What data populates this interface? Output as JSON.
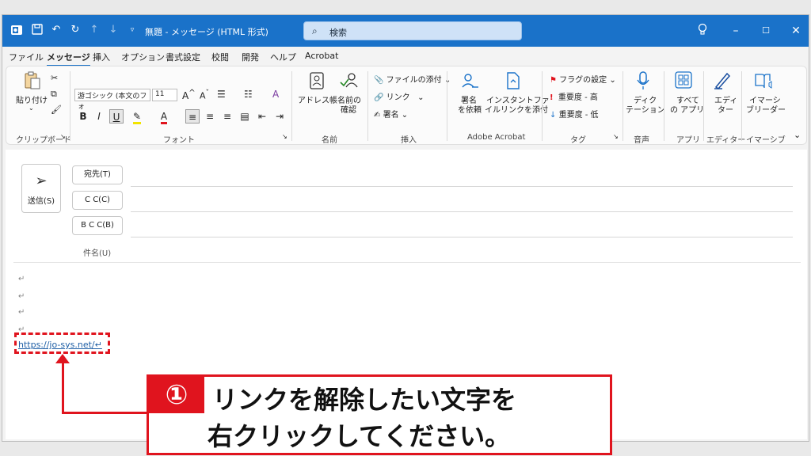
{
  "titlebar": {
    "title": "無題 - メッセージ (HTML 形式)",
    "search_placeholder": "検索"
  },
  "menu": [
    "ファイル",
    "メッセージ",
    "挿入",
    "オプション",
    "書式設定",
    "校閲",
    "開発",
    "ヘルプ",
    "Acrobat"
  ],
  "ribbon": {
    "clipboard": {
      "paste": "貼り付け",
      "label": "クリップボード"
    },
    "font": {
      "family": "游ゴシック (本文のフォ",
      "size": "11",
      "label": "フォント"
    },
    "names": {
      "address_book": "アドレス帳",
      "check_names_1": "名前の",
      "check_names_2": "確認",
      "label": "名前"
    },
    "insert": {
      "attach": "ファイルの添付",
      "link": "リンク",
      "signature": "署名",
      "label": "挿入"
    },
    "acrobat": {
      "sign_1": "署名",
      "sign_2": "を依頼",
      "instant_1": "インスタントファ",
      "instant_2": "イルリンクを添付",
      "label": "Adobe Acrobat"
    },
    "tags": {
      "flag": "フラグの設定",
      "high": "重要度 - 高",
      "low": "重要度 - 低",
      "label": "タグ"
    },
    "voice": {
      "dictate_1": "ディク",
      "dictate_2": "テーション",
      "label": "音声"
    },
    "apps": {
      "all_1": "すべて",
      "all_2": "の アプリ",
      "label": "アプリ"
    },
    "editor": {
      "editor_1": "エディ",
      "editor_2": "ター",
      "label": "エディター"
    },
    "immersive": {
      "reader_1": "イマーシ",
      "reader_2": "ブリーダー",
      "label": "イマーシブ"
    }
  },
  "compose": {
    "send": "送信(S)",
    "to": "宛先(T)",
    "cc": "C C(C)",
    "bcc": "B C C(B)",
    "subject": "件名(U)",
    "paragraph_mark": "↵",
    "link_text": "https://jo-sys.net/↵"
  },
  "callout": {
    "number": "①",
    "line1": "リンクを解除したい文字を",
    "line2": "右クリックしてください。"
  }
}
